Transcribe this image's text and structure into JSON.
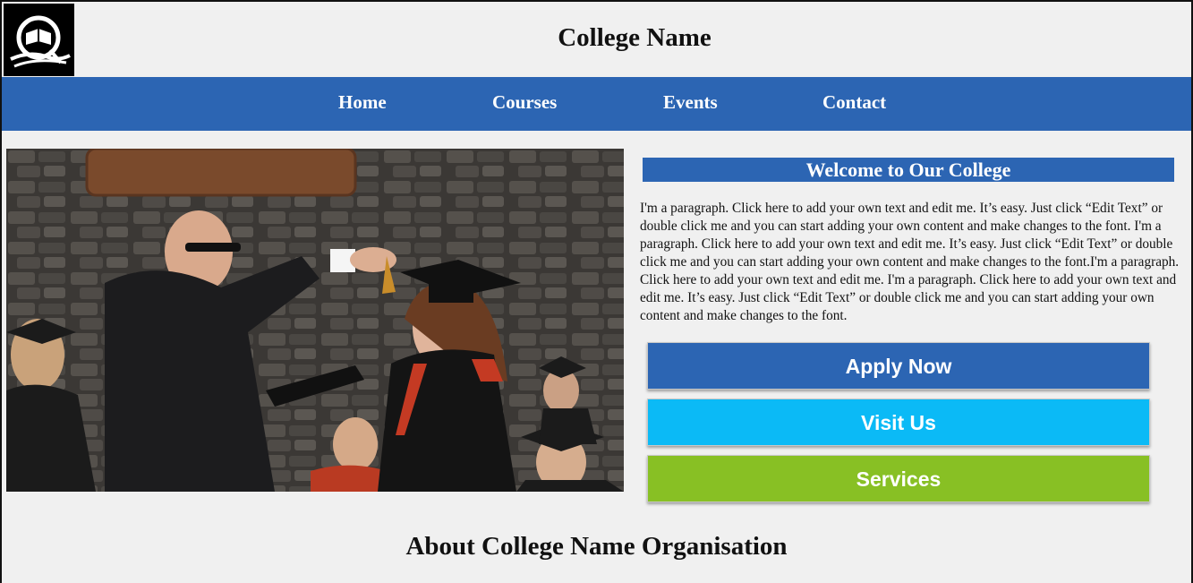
{
  "header": {
    "logo_icon": "college-book-emblem-icon",
    "title": "College Name"
  },
  "nav": {
    "items": [
      {
        "label": "Home"
      },
      {
        "label": "Courses"
      },
      {
        "label": "Events"
      },
      {
        "label": "Contact"
      }
    ],
    "color": "#2c65b3"
  },
  "hero": {
    "image": "graduation-ceremony-photo"
  },
  "welcome": {
    "heading": "Welcome to Our College",
    "paragraph": "I'm a paragraph. Click here to add your own text and edit me. It’s easy. Just click “Edit Text” or double click me and you can start adding your own content and make changes to the font. I'm a paragraph. Click here to add your own text and edit me. It’s easy. Just click “Edit Text” or double click me and you can start adding your own content and make changes to the font.I'm a paragraph. Click here to add your own text and edit me. I'm a paragraph. Click here to add your own text and edit me. It’s easy. Just click “Edit Text” or double click me and you can start adding your own content and make changes to the font."
  },
  "buttons": {
    "apply": {
      "label": "Apply Now",
      "color": "#2c65b3"
    },
    "visit": {
      "label": "Visit Us",
      "color": "#0bbaf6"
    },
    "services": {
      "label": "Services",
      "color": "#88c024"
    }
  },
  "about": {
    "heading": "About College Name Organisation"
  }
}
